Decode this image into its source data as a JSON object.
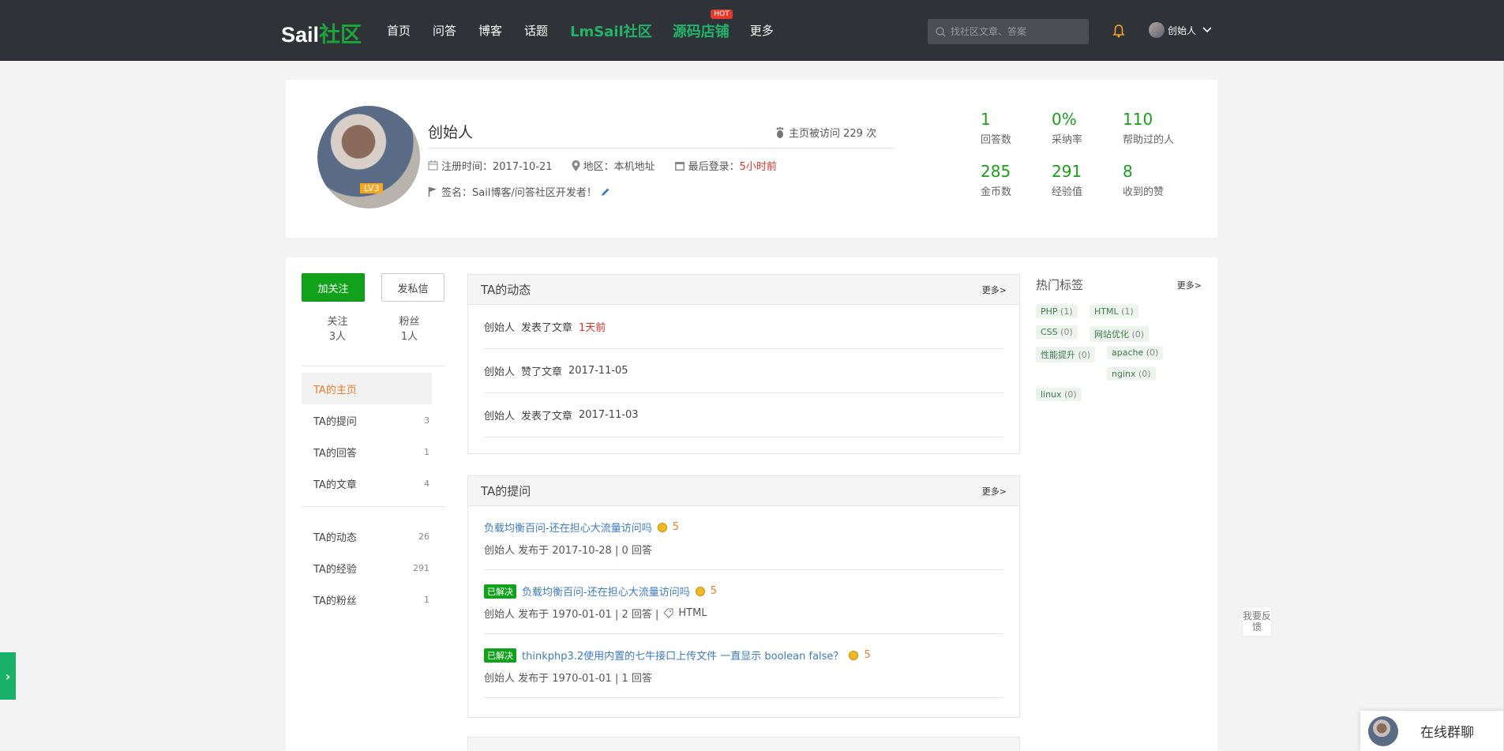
{
  "topbar": {
    "logo_a": "Sail",
    "logo_b": "社区",
    "nav": [
      "首页",
      "问答",
      "博客",
      "话题"
    ],
    "nav_big": [
      "LmSail社区",
      "源码店铺"
    ],
    "hot": "HOT",
    "more": "更多",
    "search_placeholder": "找社区文章、答案",
    "user": "创始人"
  },
  "profile": {
    "name": "创始人",
    "level": "LV3",
    "visits": "主页被访问 229 次",
    "register": "注册时间：2017-10-21",
    "region": "地区：本机地址",
    "last_login_label": "最后登录：",
    "last_login_value": "5小时前",
    "signature": "签名：Sail博客/问答社区开发者！",
    "stats": [
      {
        "num": "1",
        "label": "回答数"
      },
      {
        "num": "0%",
        "label": "采纳率"
      },
      {
        "num": "110",
        "label": "帮助过的人"
      },
      {
        "num": "285",
        "label": "金币数"
      },
      {
        "num": "291",
        "label": "经验值"
      },
      {
        "num": "8",
        "label": "收到的赞"
      }
    ]
  },
  "sidebar": {
    "follow_btn": "加关注",
    "msg_btn": "发私信",
    "following_label": "关注",
    "following_val": "3人",
    "fans_label": "粉丝",
    "fans_val": "1人",
    "menu1": [
      {
        "label": "TA的主页",
        "count": ""
      },
      {
        "label": "TA的提问",
        "count": "3"
      },
      {
        "label": "TA的回答",
        "count": "1"
      },
      {
        "label": "TA的文章",
        "count": "4"
      }
    ],
    "menu2": [
      {
        "label": "TA的动态",
        "count": "26"
      },
      {
        "label": "TA的经验",
        "count": "291"
      },
      {
        "label": "TA的粉丝",
        "count": "1"
      }
    ]
  },
  "activity": {
    "title": "TA的动态",
    "more": "更多>",
    "items": [
      {
        "user": "创始人",
        "action": "发表了文章",
        "time": "1天前",
        "red": true
      },
      {
        "user": "创始人",
        "action": "赞了文章",
        "time": "2017-11-05",
        "red": false
      },
      {
        "user": "创始人",
        "action": "发表了文章",
        "time": "2017-11-03",
        "red": false
      }
    ]
  },
  "questions": {
    "title": "TA的提问",
    "more": "更多>",
    "solved": "已解决",
    "items": [
      {
        "title": "负载均衡百问-还在担心大流量访问吗",
        "reward": "5",
        "meta": "创始人 发布于 2017-10-28  |  0 回答",
        "tag": ""
      },
      {
        "title": "负载均衡百问-还在担心大流量访问吗",
        "reward": "5",
        "meta": "创始人 发布于 1970-01-01  |  2 回答   |",
        "tag": "HTML"
      },
      {
        "title": "thinkphp3.2使用内置的七牛接口上传文件 一直显示 boolean false？",
        "reward": "5",
        "meta": "创始人 发布于 1970-01-01  |  1 回答",
        "tag": ""
      }
    ]
  },
  "tags": {
    "title": "热门标签",
    "more": "更多>",
    "items": [
      {
        "name": "PHP",
        "count": "(1)"
      },
      {
        "name": "HTML",
        "count": "(1)"
      },
      {
        "name": "CSS",
        "count": "(0)"
      },
      {
        "name": "网站优化",
        "count": "(0)"
      },
      {
        "name": "性能提升",
        "count": "(0)"
      },
      {
        "name": "apache",
        "count": "(0)"
      },
      {
        "name": "nginx",
        "count": "(0)"
      },
      {
        "name": "linux",
        "count": "(0)"
      }
    ]
  },
  "widgets": {
    "feedback": "我要反馈",
    "chat": "在线群聊",
    "side_tab": "›"
  },
  "colors": {
    "accent_green": "#11a11b",
    "brand_green": "#1aa53a",
    "orange": "#f07b28",
    "red": "#e4342a"
  }
}
